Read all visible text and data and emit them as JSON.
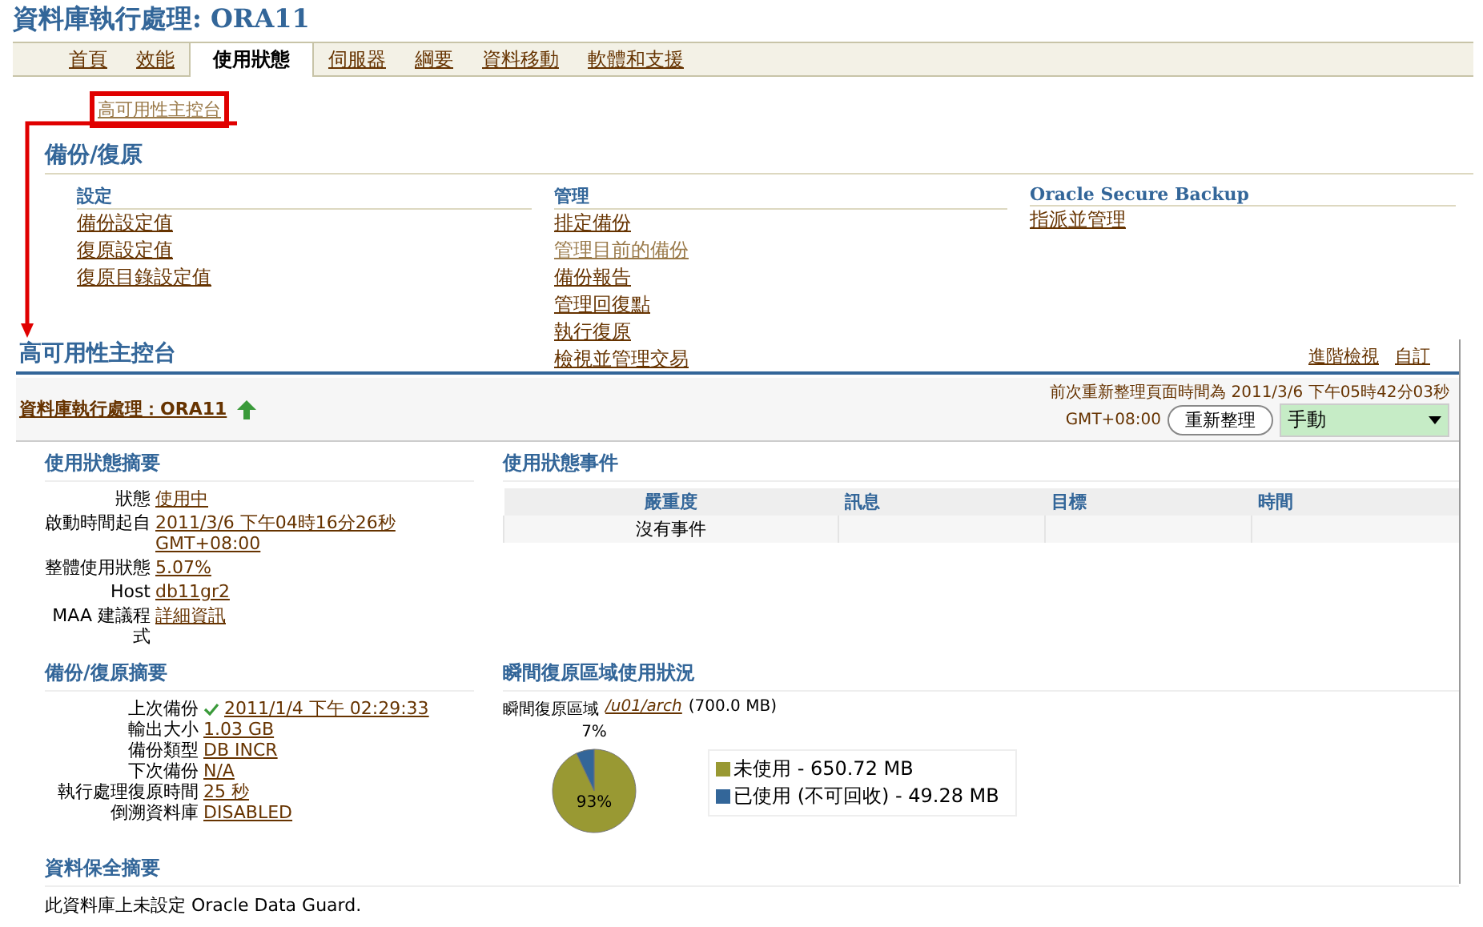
{
  "page_title": "資料庫執行處理: ORA11",
  "tabs": [
    {
      "label": "首頁",
      "selected": false
    },
    {
      "label": "效能",
      "selected": false
    },
    {
      "label": "使用狀態",
      "selected": true
    },
    {
      "label": "伺服器",
      "selected": false
    },
    {
      "label": "綱要",
      "selected": false
    },
    {
      "label": "資料移動",
      "selected": false
    },
    {
      "label": "軟體和支援",
      "selected": false
    }
  ],
  "highlighted_link": {
    "label": "高可用性主控台",
    "visited": true
  },
  "backup_section": {
    "title": "備份/復原",
    "columns": [
      {
        "heading": "設定",
        "links": [
          {
            "label": "備份設定值",
            "visited": false
          },
          {
            "label": "復原設定值",
            "visited": false
          },
          {
            "label": "復原目錄設定值",
            "visited": false
          }
        ]
      },
      {
        "heading": "管理",
        "links": [
          {
            "label": "排定備份",
            "visited": false
          },
          {
            "label": "管理目前的備份",
            "visited": true
          },
          {
            "label": "備份報告",
            "visited": false
          },
          {
            "label": "管理回復點",
            "visited": false
          },
          {
            "label": "執行復原",
            "visited": false
          },
          {
            "label": "檢視並管理交易",
            "visited": false
          }
        ]
      },
      {
        "heading": "Oracle Secure Backup",
        "links": [
          {
            "label": "指派並管理",
            "visited": false
          }
        ]
      }
    ]
  },
  "console": {
    "title": "高可用性主控台",
    "header_links": [
      "進階檢視",
      "自訂"
    ],
    "instance_link": "資料庫執行處理：ORA11",
    "refresh_text": "前次重新整理頁面時間為 2011/3/6 下午05時42分03秒",
    "refresh_tz": "GMT+08:00",
    "refresh_button": "重新整理",
    "refresh_mode": "手動",
    "status_summary": {
      "title": "使用狀態摘要",
      "rows": [
        {
          "label": "狀態",
          "value": "使用中"
        },
        {
          "label": "啟動時間起自",
          "value": "2011/3/6 下午04時16分26秒 GMT+08:00"
        },
        {
          "label": "整體使用狀態",
          "value": "5.07%"
        },
        {
          "label": "Host",
          "value": "db11gr2"
        },
        {
          "label": "MAA 建議程式",
          "value": "詳細資訊"
        }
      ]
    },
    "events": {
      "title": "使用狀態事件",
      "columns": [
        "嚴重度",
        "訊息",
        "目標",
        "時間"
      ],
      "empty_text": "沒有事件"
    },
    "backup_summary": {
      "title": "備份/復原摘要",
      "rows": [
        {
          "label": "上次備份",
          "value": "2011/1/4 下午 02:29:33",
          "succeeded": true
        },
        {
          "label": "輸出大小",
          "value": "1.03 GB",
          "succeeded": false
        },
        {
          "label": "備份類型",
          "value": "DB INCR",
          "succeeded": false
        },
        {
          "label": "下次備份",
          "value": "N/A",
          "succeeded": false
        },
        {
          "label": "執行處理復原時間",
          "value": "25 秒",
          "succeeded": false
        },
        {
          "label": "倒溯資料庫",
          "value": "DISABLED",
          "succeeded": false
        }
      ]
    },
    "recovery_area": {
      "title": "瞬間復原區域使用狀況",
      "label": "瞬間復原區域",
      "path_link": "/u01/arch",
      "size_text": "(700.0 MB)",
      "chart_data": {
        "type": "pie",
        "categories": [
          "未使用 - 650.72 MB",
          "已使用 (不可回收) - 49.28 MB"
        ],
        "series": [
          {
            "values": [
              93,
              7
            ]
          }
        ],
        "colors": [
          "#999933",
          "#336699"
        ],
        "value_labels": [
          "93%",
          "7%"
        ],
        "legend": "right"
      }
    },
    "data_protection": {
      "title": "資料保全摘要",
      "text": "此資料庫上未設定 Oracle Data Guard."
    }
  }
}
